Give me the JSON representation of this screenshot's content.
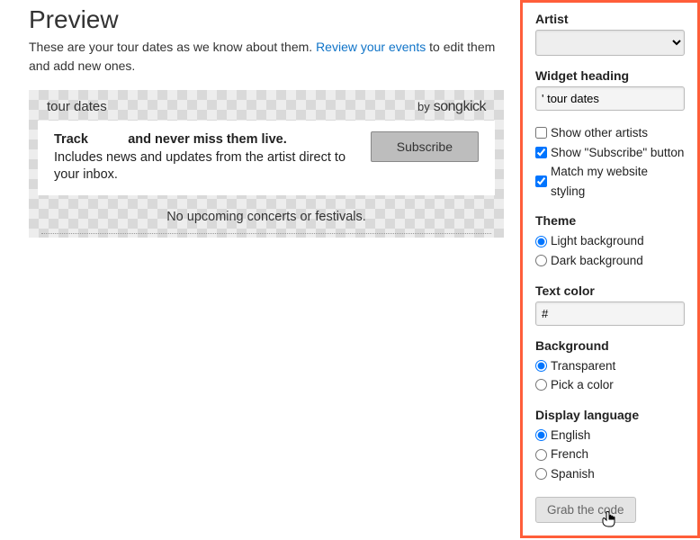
{
  "preview": {
    "title": "Preview",
    "desc_pre": "These are your tour dates as we know about them. ",
    "desc_link": "Review your events",
    "desc_post": " to edit them and add new ones."
  },
  "widget": {
    "title_suffix": "tour dates",
    "by": "by",
    "brand": "songkick",
    "track_prefix": "Track",
    "track_suffix": "and never miss them live.",
    "includes": "Includes news and updates from the artist direct to your inbox.",
    "subscribe": "Subscribe",
    "empty": "No upcoming concerts or festivals."
  },
  "settings": {
    "artist_label": "Artist",
    "artist_value": "",
    "heading_label": "Widget heading",
    "heading_value": "' tour dates",
    "cb_other": "Show other artists",
    "cb_subscribe": "Show \"Subscribe\" button",
    "cb_match": "Match my website styling",
    "theme_label": "Theme",
    "theme_light": "Light background",
    "theme_dark": "Dark background",
    "textcolor_label": "Text color",
    "textcolor_value": "#",
    "bg_label": "Background",
    "bg_transparent": "Transparent",
    "bg_pick": "Pick a color",
    "lang_label": "Display language",
    "lang_en": "English",
    "lang_fr": "French",
    "lang_es": "Spanish",
    "grab": "Grab the code"
  }
}
